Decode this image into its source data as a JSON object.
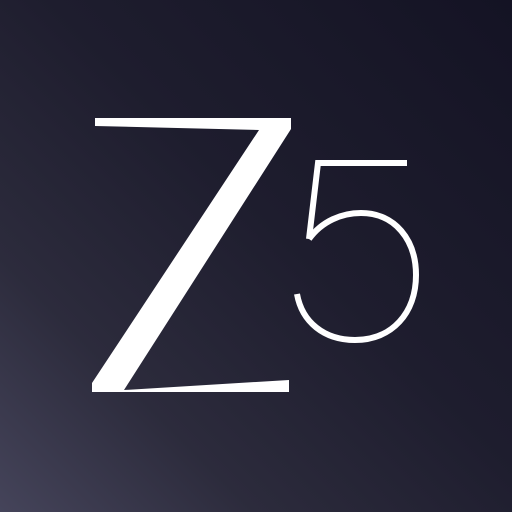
{
  "logo": {
    "letter": "Z",
    "digit": "5",
    "foreground_color": "#ffffff",
    "background_gradient": [
      "#141324",
      "#1e1d2e",
      "#2c2b3c",
      "#45445a"
    ]
  }
}
